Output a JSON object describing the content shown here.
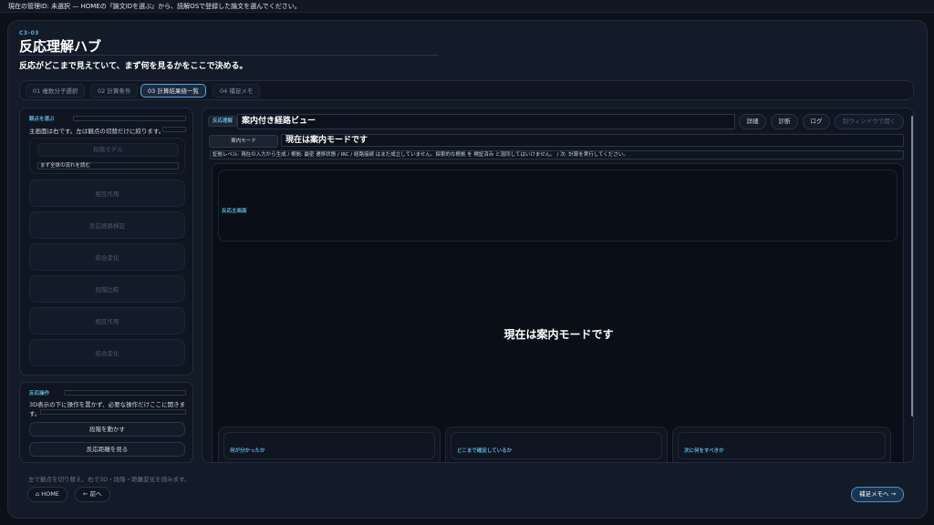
{
  "topbar": {
    "text": "現在の管理ID: 未選択 — HOMEの『論文IDを選ぶ』から、読解OSで登録した論文を選んでください。"
  },
  "header": {
    "code": "C3-03",
    "title": "反応理解ハブ",
    "subtitle": "反応がどこまで見えていて、まず何を見るかをここで決める。"
  },
  "tabs": [
    {
      "label": "01 複数分子選択"
    },
    {
      "label": "02 計算条件"
    },
    {
      "label": "03 計算結果値一覧"
    },
    {
      "label": "04 補足メモ"
    }
  ],
  "viewpoint": {
    "section_label": "観点を選ぶ",
    "description": "主画面は右です。左は観点の切替だけに絞ります。",
    "card_title": "段階モデル",
    "card_hint": "まず全体の流れを読む",
    "buttons": [
      "相互作用",
      "反応経路検証",
      "結合変化",
      "段階比較",
      "相互作用",
      "結合変化"
    ]
  },
  "operations": {
    "section_label": "反応操作",
    "description_line1": "3D表示の下に操作を置かず、必要な操作だけここに開きま",
    "description_line2": "す。",
    "buttons": [
      "段階を動かす",
      "反応距離を見る"
    ]
  },
  "main": {
    "chip": "反応理解",
    "view_title": "案内付き経路ビュー",
    "header_buttons": [
      "詳細",
      "診断",
      "ログ",
      "別ウィンドウで開く"
    ],
    "mode_chip": "案内モード",
    "mode_text": "現在は案内モードです",
    "evidence": "証拠レベル: 現在の入力から生成 / 根拠: 最密 遷移状態 / IRC / 経路接続 はまだ成立していません。探索的な根拠 を 検証済み と混同してはいけません。 / 次: 計算を実行してください。",
    "stage_label": "反応主画面",
    "stage_message": "現在は案内モードです",
    "info_cards": [
      "何が分かったか",
      "どこまで確定しているか",
      "次に何をすべきか"
    ]
  },
  "footer": {
    "note": "左で観点を切り替え、右で3D・段階・距離変化を読みます。",
    "home": "⌂ HOME",
    "back": "← 前へ",
    "next": "補足メモへ →"
  },
  "colors": {
    "accent": "#5fb0d8",
    "background": "#0b1019",
    "panel": "#131b28"
  }
}
